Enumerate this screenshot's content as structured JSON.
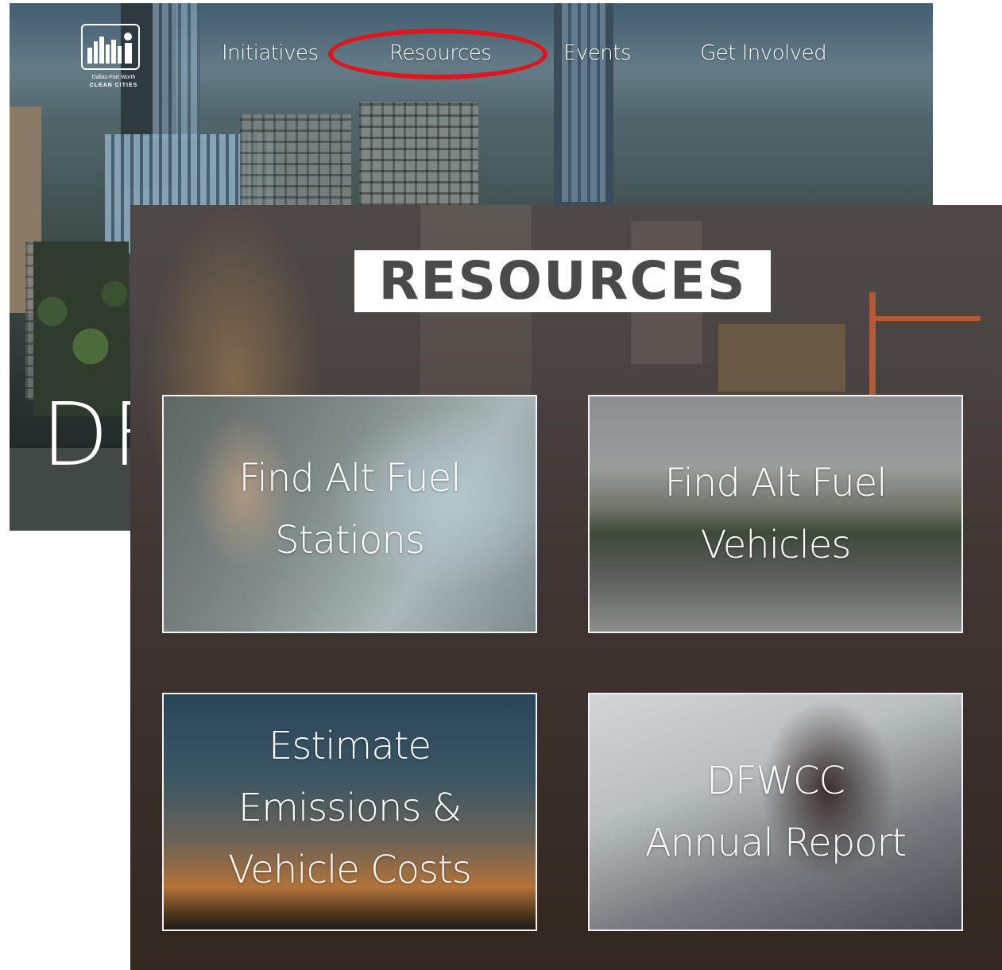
{
  "home": {
    "logo": {
      "line1": "Dallas·Fort Worth",
      "line2": "CLEAN CITIES"
    },
    "nav": {
      "items": [
        {
          "label": "Initiatives"
        },
        {
          "label": "Resources"
        },
        {
          "label": "Events"
        },
        {
          "label": "Get Involved"
        }
      ],
      "highlighted": "Resources",
      "highlight_color": "#e3141b"
    },
    "hero_partial_text": "DF"
  },
  "resources_page": {
    "title": "RESOURCES",
    "tiles": [
      {
        "label_lines": [
          "Find Alt Fuel",
          "Stations"
        ]
      },
      {
        "label_lines": [
          "Find Alt Fuel",
          "Vehicles"
        ]
      },
      {
        "label_lines": [
          "Estimate",
          "Emissions &",
          "Vehicle Costs"
        ]
      },
      {
        "label_lines": [
          "DFWCC",
          "Annual Report"
        ]
      }
    ]
  },
  "colors": {
    "tile_border": "#f2f2f2",
    "title_box": "#ffffff",
    "title_text": "#4a4a4a"
  }
}
